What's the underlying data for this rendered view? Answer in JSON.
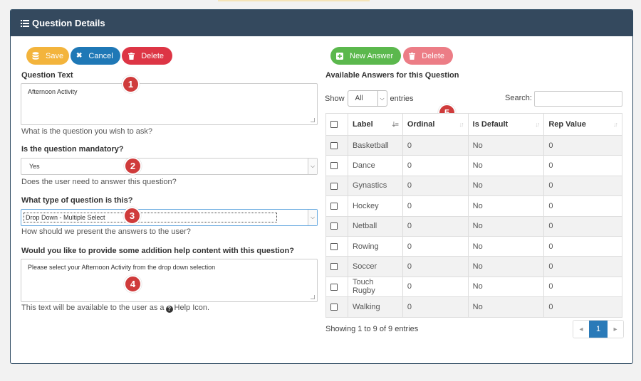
{
  "panel": {
    "title": "Question Details"
  },
  "left_toolbar": {
    "save_label": "Save",
    "cancel_label": "Cancel",
    "delete_label": "Delete"
  },
  "question_text": {
    "label": "Question Text",
    "value": "Afternoon Activity",
    "help": "What is the question you wish to ask?"
  },
  "mandatory": {
    "label": "Is the question mandatory?",
    "value": "Yes",
    "help": "Does the user need to answer this question?"
  },
  "question_type": {
    "label": "What type of question is this?",
    "value": "Drop Down - Multiple Select",
    "help": "How should we present the answers to the user?"
  },
  "help_content": {
    "label": "Would you like to provide some addition help content with this question?",
    "value": "Please select your Afternoon Activity from the drop down selection",
    "help_prefix": "This text will be available to the user as a",
    "help_suffix": "Help Icon."
  },
  "badges": [
    "1",
    "2",
    "3",
    "4",
    "5"
  ],
  "right_toolbar": {
    "new_label": "New Answer",
    "delete_label": "Delete"
  },
  "answers": {
    "heading": "Available Answers for this Question",
    "show_label": "Show",
    "show_value": "All",
    "entries_label": "entries",
    "search_label": "Search:",
    "columns": [
      "Label",
      "Ordinal",
      "Is Default",
      "Rep Value"
    ],
    "rows": [
      [
        "Basketball",
        "0",
        "No",
        "0"
      ],
      [
        "Dance",
        "0",
        "No",
        "0"
      ],
      [
        "Gynastics",
        "0",
        "No",
        "0"
      ],
      [
        "Hockey",
        "0",
        "No",
        "0"
      ],
      [
        "Netball",
        "0",
        "No",
        "0"
      ],
      [
        "Rowing",
        "0",
        "No",
        "0"
      ],
      [
        "Soccer",
        "0",
        "No",
        "0"
      ],
      [
        "Touch Rugby",
        "0",
        "No",
        "0"
      ],
      [
        "Walking",
        "0",
        "No",
        "0"
      ]
    ],
    "info": "Showing 1 to 9 of 9 entries",
    "current_page": "1"
  }
}
